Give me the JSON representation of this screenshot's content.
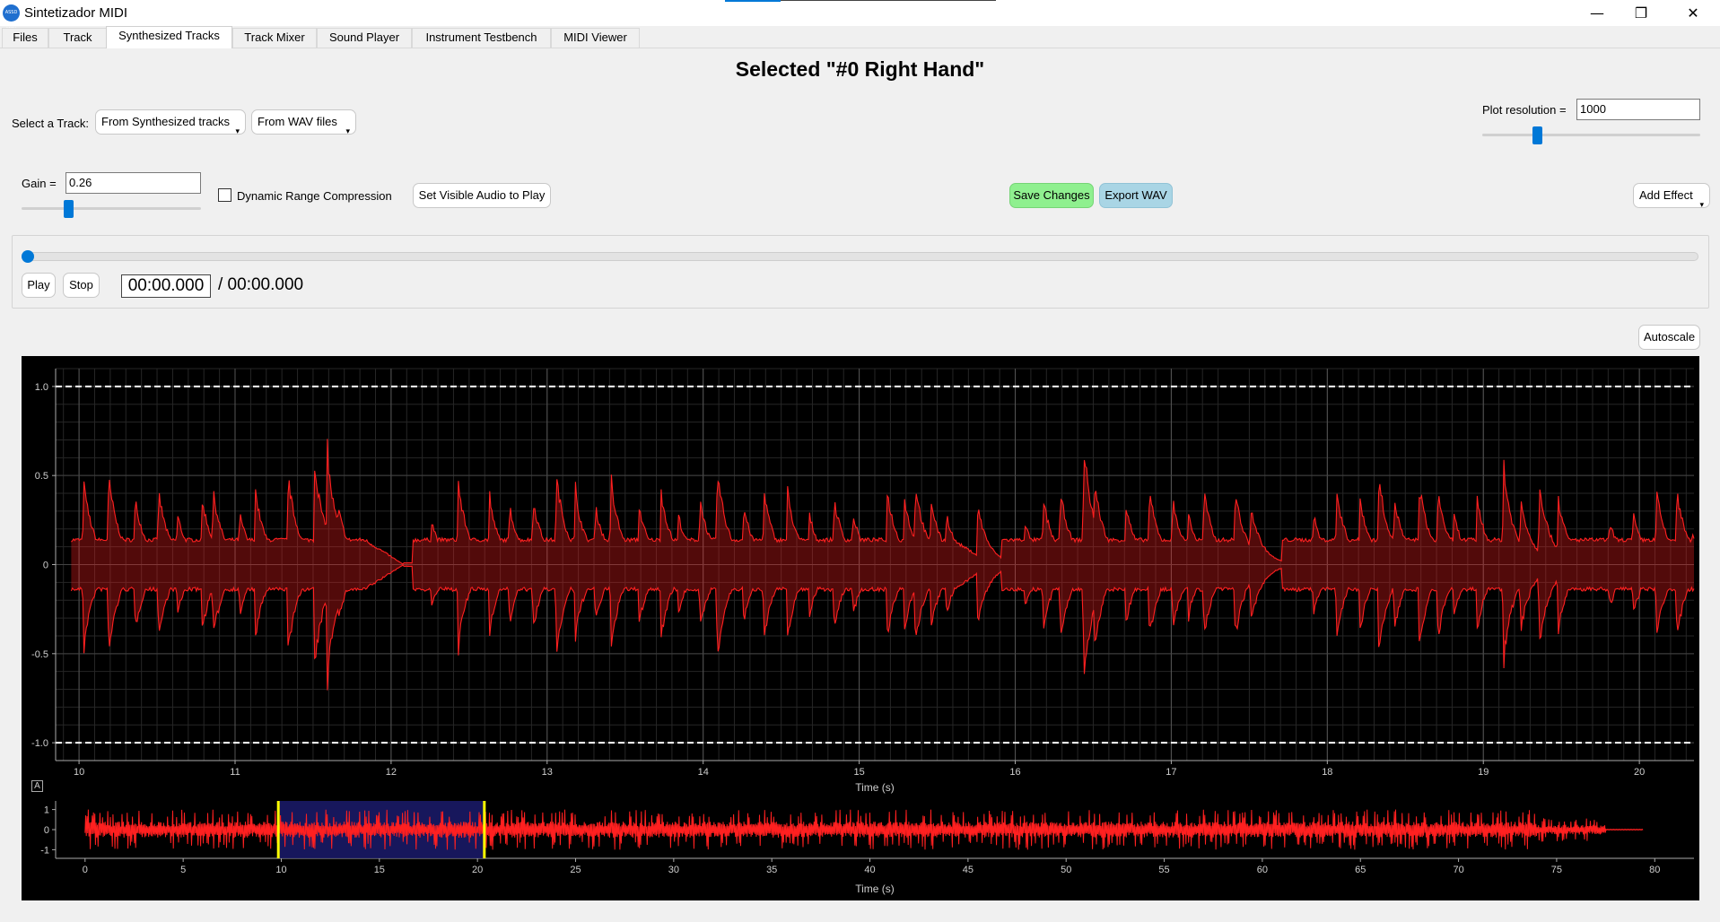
{
  "window": {
    "title": "Sintetizador MIDI",
    "minimize_glyph": "—",
    "restore_glyph": "❐",
    "close_glyph": "✕",
    "icon_text": "ASSD MIDI"
  },
  "tabs": [
    {
      "label": "Files",
      "active": false
    },
    {
      "label": "Track",
      "active": false
    },
    {
      "label": "Synthesized Tracks",
      "active": true
    },
    {
      "label": "Track Mixer",
      "active": false
    },
    {
      "label": "Sound Player",
      "active": false
    },
    {
      "label": "Instrument Testbench",
      "active": false
    },
    {
      "label": "MIDI Viewer",
      "active": false
    }
  ],
  "heading": "Selected  \"#0  Right Hand\"",
  "track_select": {
    "label": "Select a Track:",
    "synth_combo": "From Synthesized tracks",
    "wav_combo": "From WAV files"
  },
  "plot_resolution": {
    "label": "Plot resolution =",
    "value": "1000",
    "slider_fraction": 0.25
  },
  "gain": {
    "label": "Gain =",
    "value": "0.26",
    "slider_fraction": 0.26
  },
  "compression": {
    "label": "Dynamic Range Compression",
    "checked": false
  },
  "buttons": {
    "set_visible": "Set Visible Audio to Play",
    "save_changes": "Save Changes",
    "export_wav": "Export WAV",
    "add_effect": "Add Effect",
    "play": "Play",
    "stop": "Stop",
    "autoscale": "Autoscale"
  },
  "player": {
    "current_time": "00:00.000",
    "total_time": "/ 00:00.000",
    "progress": 0.0
  },
  "colors": {
    "accent": "#0078d7",
    "waveform": "#ff2020",
    "save_button": "#8ff08f",
    "export_button": "#a9d5e5",
    "plot_background": "#000000",
    "selection_region": "#1a1a66",
    "selection_bounds": "#ffff00"
  },
  "icons": {
    "combo_arrow": "▾",
    "autorange_badge": "A"
  },
  "chart_data": [
    {
      "type": "line",
      "name": "main-waveform",
      "xlabel": "Time (s)",
      "ylabel": "",
      "xlim": [
        9.85,
        20.35
      ],
      "ylim": [
        -1.1,
        1.1
      ],
      "xticks": [
        "10",
        "11",
        "12",
        "13",
        "14",
        "15",
        "16",
        "17",
        "18",
        "19",
        "20"
      ],
      "yticks": [
        "1.0",
        "0.5",
        "0",
        "-0.5",
        "-1.0"
      ],
      "limit_lines": [
        1.0,
        -1.0
      ],
      "grid": true,
      "note_onsets": [
        10.02,
        10.18,
        10.35,
        10.5,
        10.62,
        10.78,
        10.85,
        11.02,
        11.12,
        11.33,
        11.5,
        11.58,
        11.65,
        12.25,
        12.42,
        12.62,
        12.75,
        12.9,
        13.05,
        13.17,
        13.3,
        13.4,
        13.58,
        13.72,
        13.83,
        13.97,
        14.08,
        14.25,
        14.38,
        14.53,
        14.67,
        14.83,
        14.95,
        15.17,
        15.28,
        15.35,
        15.45,
        15.55,
        15.75,
        16.05,
        16.17,
        16.28,
        16.43,
        16.5,
        16.7,
        16.85,
        17.0,
        17.1,
        17.2,
        17.4,
        17.5,
        17.9,
        18.05,
        18.2,
        18.32,
        18.42,
        18.58,
        18.7,
        18.8,
        18.95,
        19.12,
        19.23,
        19.35,
        19.47,
        19.8,
        19.95,
        20.1,
        20.23,
        20.33
      ],
      "peak_amplitudes": [
        0.55,
        0.6,
        0.45,
        0.5,
        0.35,
        0.45,
        0.5,
        0.35,
        0.5,
        0.6,
        0.7,
        0.75,
        0.4,
        0.3,
        0.55,
        0.45,
        0.4,
        0.45,
        0.6,
        0.5,
        0.4,
        0.55,
        0.4,
        0.5,
        0.35,
        0.45,
        0.65,
        0.4,
        0.5,
        0.5,
        0.35,
        0.45,
        0.35,
        0.5,
        0.45,
        0.55,
        0.45,
        0.35,
        0.4,
        0.3,
        0.45,
        0.5,
        0.8,
        0.55,
        0.4,
        0.5,
        0.45,
        0.35,
        0.5,
        0.5,
        0.4,
        0.35,
        0.5,
        0.45,
        0.6,
        0.45,
        0.55,
        0.5,
        0.35,
        0.45,
        0.65,
        0.45,
        0.55,
        0.45,
        0.3,
        0.35,
        0.5,
        0.5,
        0.2
      ],
      "silence_gaps": [
        12.08,
        15.85,
        17.65,
        19.45
      ]
    },
    {
      "type": "line",
      "name": "overview-waveform",
      "xlabel": "Time (s)",
      "ylabel": "",
      "xlim": [
        -1.5,
        82
      ],
      "ylim": [
        -1.25,
        1.25
      ],
      "xticks": [
        "0",
        "5",
        "10",
        "15",
        "20",
        "25",
        "30",
        "35",
        "40",
        "45",
        "50",
        "55",
        "60",
        "65",
        "70",
        "75",
        "80"
      ],
      "yticks": [
        "1",
        "0",
        "-1"
      ],
      "duration": 79.4,
      "selection": [
        9.85,
        20.35
      ]
    }
  ]
}
